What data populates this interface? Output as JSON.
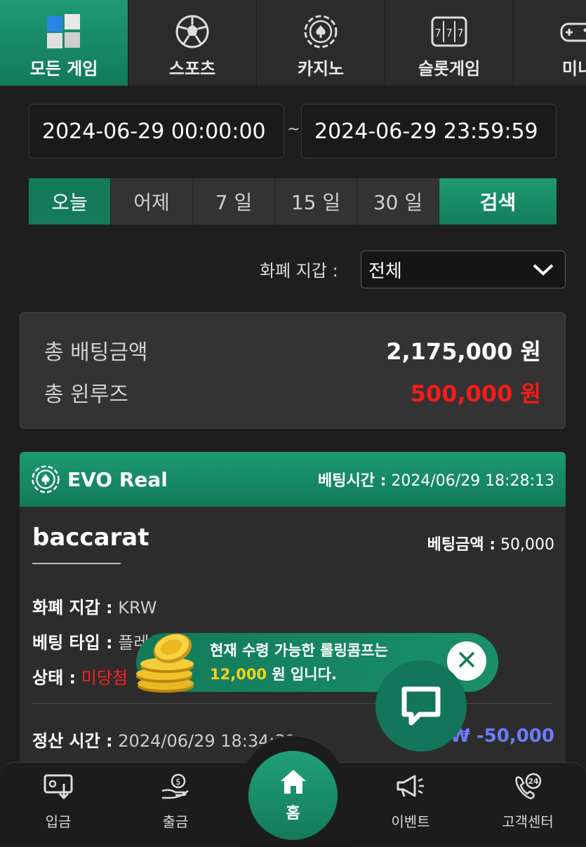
{
  "top_nav": {
    "tabs": [
      {
        "label": "모든 게임",
        "icon": "all-games-icon",
        "active": true
      },
      {
        "label": "스포츠",
        "icon": "soccer-ball-icon",
        "active": false
      },
      {
        "label": "카지노",
        "icon": "casino-chip-icon",
        "active": false
      },
      {
        "label": "슬롯게임",
        "icon": "slot-machine-icon",
        "active": false
      },
      {
        "label": "미니",
        "icon": "gamepad-icon",
        "active": false
      }
    ]
  },
  "filters": {
    "date_from": "2024-06-29 00:00:00",
    "date_separator": "~",
    "date_to": "2024-06-29 23:59:59",
    "periods": [
      "오늘",
      "어제",
      "7 일",
      "15 일",
      "30 일"
    ],
    "active_period": "오늘",
    "search_label": "검색",
    "wallet_label": "화폐 지갑 :",
    "wallet_value": "전체"
  },
  "summary": {
    "total_bet_label": "총 배팅금액",
    "total_bet_value": "2,175,000 원",
    "total_winloss_label": "총 윈루즈",
    "total_winloss_value": "500,000 원"
  },
  "bet_card": {
    "provider": "EVO Real",
    "bet_time_label": "베팅시간 :",
    "bet_time": "2024/06/29 18:28:13",
    "game": "baccarat",
    "bet_amount_label": "베팅금액 :",
    "bet_amount": "50,000",
    "wallet_label": "화폐 지갑 :",
    "wallet": "KRW",
    "bet_type_label": "베팅 타입 :",
    "bet_type": "플레이어",
    "status_label": "상태 :",
    "status": "미당첨",
    "settle_label": "정산 시간 :",
    "settle_time": "2024/06/29 18:34:31",
    "payout": "₩ -50,000"
  },
  "promo": {
    "line1": "현재 수령 가능한 롤링콤프는",
    "amount": "12,000",
    "line2_suffix": "원 입니다."
  },
  "bottom_nav": {
    "deposit": "입금",
    "withdraw": "출금",
    "home": "홈",
    "event": "이벤트",
    "support": "고객센터"
  },
  "colors": {
    "accent": "#1a8f69",
    "loss_red": "#ff1a1a",
    "payout_blue": "#6d7cff",
    "promo_yellow": "#ffd21a"
  }
}
